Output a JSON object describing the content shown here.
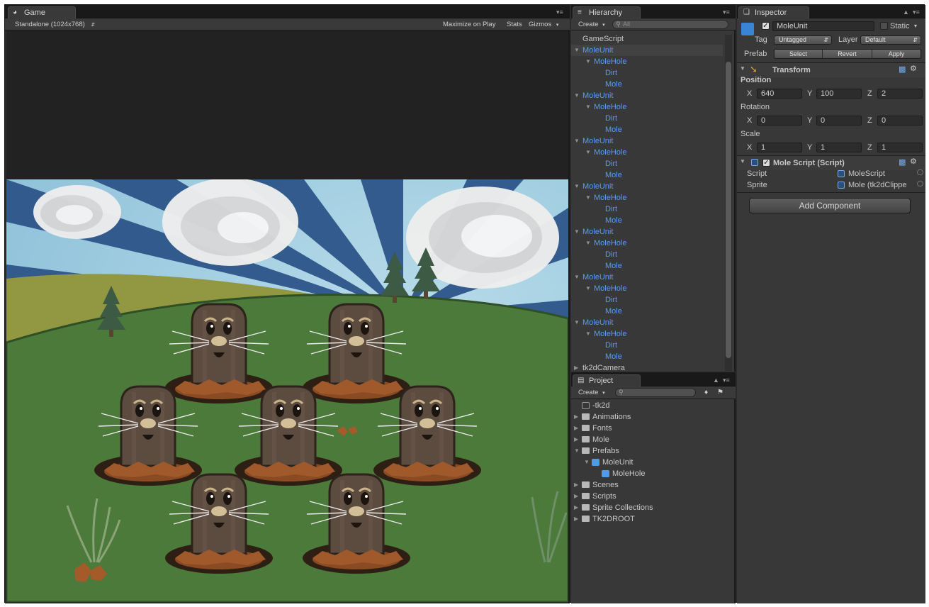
{
  "game": {
    "tab_label": "Game",
    "resolution": "Standalone (1024x768)",
    "maximize_on_play": "Maximize on Play",
    "stats": "Stats",
    "gizmos": "Gizmos"
  },
  "hierarchy": {
    "tab_label": "Hierarchy",
    "create": "Create",
    "search_placeholder": "All",
    "items": [
      {
        "label": "GameScript",
        "depth": 0,
        "color": "white",
        "arrow": false,
        "selected": false
      },
      {
        "label": "MoleUnit",
        "depth": 0,
        "color": "blue",
        "arrow": true,
        "selected": true
      },
      {
        "label": "MoleHole",
        "depth": 1,
        "color": "blue",
        "arrow": true,
        "selected": false
      },
      {
        "label": "Dirt",
        "depth": 2,
        "color": "blue",
        "arrow": false,
        "selected": false
      },
      {
        "label": "Mole",
        "depth": 2,
        "color": "blue",
        "arrow": false,
        "selected": false
      },
      {
        "label": "MoleUnit",
        "depth": 0,
        "color": "blue",
        "arrow": true,
        "selected": false
      },
      {
        "label": "MoleHole",
        "depth": 1,
        "color": "blue",
        "arrow": true,
        "selected": false
      },
      {
        "label": "Dirt",
        "depth": 2,
        "color": "blue",
        "arrow": false,
        "selected": false
      },
      {
        "label": "Mole",
        "depth": 2,
        "color": "blue",
        "arrow": false,
        "selected": false
      },
      {
        "label": "MoleUnit",
        "depth": 0,
        "color": "blue",
        "arrow": true,
        "selected": false
      },
      {
        "label": "MoleHole",
        "depth": 1,
        "color": "blue",
        "arrow": true,
        "selected": false
      },
      {
        "label": "Dirt",
        "depth": 2,
        "color": "blue",
        "arrow": false,
        "selected": false
      },
      {
        "label": "Mole",
        "depth": 2,
        "color": "blue",
        "arrow": false,
        "selected": false
      },
      {
        "label": "MoleUnit",
        "depth": 0,
        "color": "blue",
        "arrow": true,
        "selected": false
      },
      {
        "label": "MoleHole",
        "depth": 1,
        "color": "blue",
        "arrow": true,
        "selected": false
      },
      {
        "label": "Dirt",
        "depth": 2,
        "color": "blue",
        "arrow": false,
        "selected": false
      },
      {
        "label": "Mole",
        "depth": 2,
        "color": "blue",
        "arrow": false,
        "selected": false
      },
      {
        "label": "MoleUnit",
        "depth": 0,
        "color": "blue",
        "arrow": true,
        "selected": false
      },
      {
        "label": "MoleHole",
        "depth": 1,
        "color": "blue",
        "arrow": true,
        "selected": false
      },
      {
        "label": "Dirt",
        "depth": 2,
        "color": "blue",
        "arrow": false,
        "selected": false
      },
      {
        "label": "Mole",
        "depth": 2,
        "color": "blue",
        "arrow": false,
        "selected": false
      },
      {
        "label": "MoleUnit",
        "depth": 0,
        "color": "blue",
        "arrow": true,
        "selected": false
      },
      {
        "label": "MoleHole",
        "depth": 1,
        "color": "blue",
        "arrow": true,
        "selected": false
      },
      {
        "label": "Dirt",
        "depth": 2,
        "color": "blue",
        "arrow": false,
        "selected": false
      },
      {
        "label": "Mole",
        "depth": 2,
        "color": "blue",
        "arrow": false,
        "selected": false
      },
      {
        "label": "MoleUnit",
        "depth": 0,
        "color": "blue",
        "arrow": true,
        "selected": false
      },
      {
        "label": "MoleHole",
        "depth": 1,
        "color": "blue",
        "arrow": true,
        "selected": false
      },
      {
        "label": "Dirt",
        "depth": 2,
        "color": "blue",
        "arrow": false,
        "selected": false
      },
      {
        "label": "Mole",
        "depth": 2,
        "color": "blue",
        "arrow": false,
        "selected": false
      },
      {
        "label": "tk2dCamera",
        "depth": 0,
        "color": "white",
        "arrow": true,
        "selected": false
      }
    ]
  },
  "project": {
    "tab_label": "Project",
    "create": "Create",
    "items": [
      {
        "label": "-tk2d",
        "depth": 0,
        "kind": "special",
        "arrow": false
      },
      {
        "label": "Animations",
        "depth": 0,
        "kind": "folder",
        "arrow": true
      },
      {
        "label": "Fonts",
        "depth": 0,
        "kind": "folder",
        "arrow": true
      },
      {
        "label": "Mole",
        "depth": 0,
        "kind": "folder",
        "arrow": true
      },
      {
        "label": "Prefabs",
        "depth": 0,
        "kind": "folder",
        "arrow": true,
        "open": true
      },
      {
        "label": "MoleUnit",
        "depth": 1,
        "kind": "prefab",
        "arrow": true,
        "open": true
      },
      {
        "label": "MoleHole",
        "depth": 2,
        "kind": "prefab",
        "arrow": false
      },
      {
        "label": "Scenes",
        "depth": 0,
        "kind": "folder",
        "arrow": true
      },
      {
        "label": "Scripts",
        "depth": 0,
        "kind": "folder",
        "arrow": true
      },
      {
        "label": "Sprite Collections",
        "depth": 0,
        "kind": "folder",
        "arrow": true
      },
      {
        "label": "TK2DROOT",
        "depth": 0,
        "kind": "folder",
        "arrow": true
      }
    ]
  },
  "inspector": {
    "tab_label": "Inspector",
    "object_name": "MoleUnit",
    "static_label": "Static",
    "tag_label": "Tag",
    "tag_value": "Untagged",
    "layer_label": "Layer",
    "layer_value": "Default",
    "prefab_label": "Prefab",
    "prefab_buttons": [
      "Select",
      "Revert",
      "Apply"
    ],
    "transform": {
      "title": "Transform",
      "position_label": "Position",
      "rotation_label": "Rotation",
      "scale_label": "Scale",
      "x_label": "X",
      "y_label": "Y",
      "z_label": "Z",
      "position": {
        "x": "640",
        "y": "100",
        "z": "2"
      },
      "rotation": {
        "x": "0",
        "y": "0",
        "z": "0"
      },
      "scale": {
        "x": "1",
        "y": "1",
        "z": "1"
      }
    },
    "mole_script": {
      "title": "Mole Script (Script)",
      "script_label": "Script",
      "script_value": "MoleScript",
      "sprite_label": "Sprite",
      "sprite_value": "Mole (tk2dClippe"
    },
    "add_component": "Add Component"
  },
  "colors": {
    "editor_bg": "#383838",
    "selection": "#414141",
    "link_blue": "#5b9bf5",
    "sky": "#2c5387",
    "sky_ray": "#a7d2e3",
    "grass": "#4b7a3a"
  }
}
